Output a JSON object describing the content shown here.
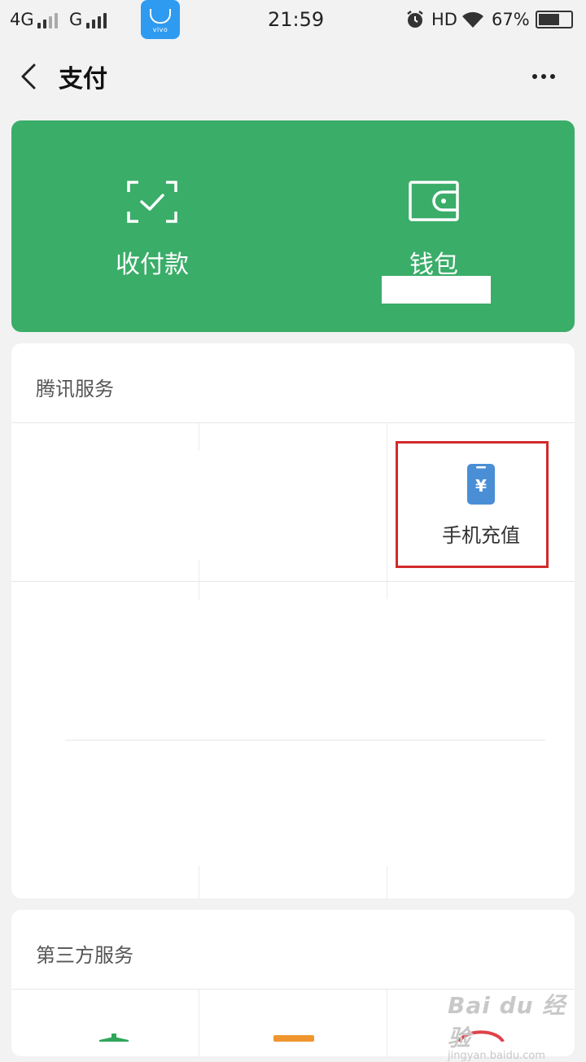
{
  "status_bar": {
    "network1": "4G",
    "network2": "G",
    "store_brand": "vivo",
    "time": "21:59",
    "hd": "HD",
    "battery": "67%",
    "battery_level": 0.67
  },
  "header": {
    "title": "支付"
  },
  "wallet_card": {
    "accent_color": "#3aad69",
    "items": [
      {
        "label": "收付款",
        "icon": "scan-check-icon"
      },
      {
        "label": "钱包",
        "icon": "wallet-icon"
      }
    ]
  },
  "tencent_services": {
    "title": "腾讯服务",
    "items": [
      {
        "label": "手机充值",
        "icon": "mobile-recharge-icon",
        "highlighted": true
      }
    ]
  },
  "third_party_services": {
    "title": "第三方服务"
  },
  "watermark": {
    "main": "Bai du 经验",
    "sub": "jingyan.baidu.com"
  }
}
